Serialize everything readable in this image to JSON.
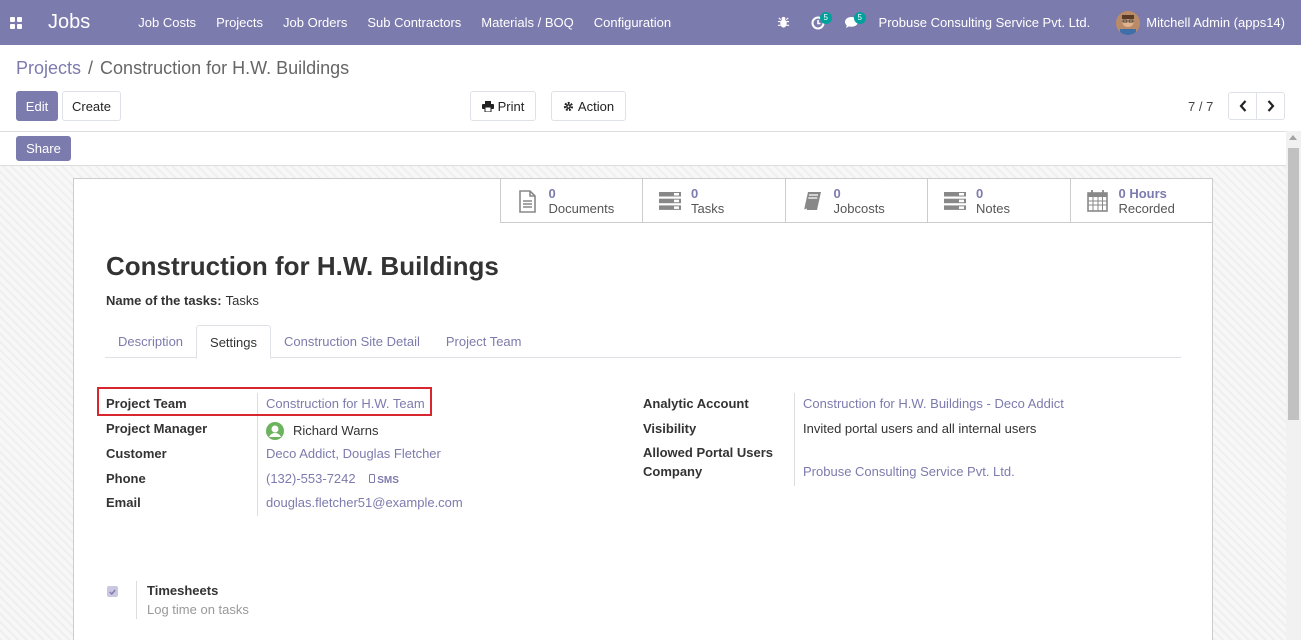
{
  "navbar": {
    "app_name": "Jobs",
    "menu": [
      "Job Costs",
      "Projects",
      "Job Orders",
      "Sub Contractors",
      "Materials / BOQ",
      "Configuration"
    ],
    "activity_count": "5",
    "messages_count": "5",
    "company": "Probuse Consulting Service Pvt. Ltd.",
    "user": "Mitchell Admin (apps14)"
  },
  "breadcrumb": {
    "parent": "Projects",
    "separator": "/",
    "current": "Construction for H.W. Buildings"
  },
  "controls": {
    "edit": "Edit",
    "create": "Create",
    "print": "Print",
    "action": "Action",
    "pager": "7 / 7",
    "share": "Share"
  },
  "smart_buttons": [
    {
      "value": "0",
      "label": "Documents",
      "icon": "document-icon"
    },
    {
      "value": "0",
      "label": "Tasks",
      "icon": "tasks-icon"
    },
    {
      "value": "0",
      "label": "Jobcosts",
      "icon": "book-icon"
    },
    {
      "value": "0",
      "label": "Notes",
      "icon": "notes-icon"
    },
    {
      "value": "0 Hours",
      "label": "Recorded",
      "icon": "calendar-icon"
    }
  ],
  "record": {
    "title": "Construction for H.W. Buildings",
    "tasks_label": "Name of the tasks:",
    "tasks_value": "Tasks"
  },
  "tabs": [
    "Description",
    "Settings",
    "Construction Site Detail",
    "Project Team"
  ],
  "left_fields": {
    "project_team": {
      "label": "Project Team",
      "value": "Construction for H.W. Team"
    },
    "project_manager": {
      "label": "Project Manager",
      "value": "Richard Warns"
    },
    "customer": {
      "label": "Customer",
      "value": "Deco Addict, Douglas Fletcher"
    },
    "phone": {
      "label": "Phone",
      "value": "(132)-553-7242",
      "sms": "SMS"
    },
    "email": {
      "label": "Email",
      "value": "douglas.fletcher51@example.com"
    }
  },
  "right_fields": {
    "analytic_account": {
      "label": "Analytic Account",
      "value": "Construction for H.W. Buildings - Deco Addict"
    },
    "visibility": {
      "label": "Visibility",
      "value": "Invited portal users and all internal users"
    },
    "allowed_portal_users": {
      "label": "Allowed Portal Users",
      "value": ""
    },
    "company": {
      "label": "Company",
      "value": "Probuse Consulting Service Pvt. Ltd."
    }
  },
  "timesheets": {
    "label": "Timesheets",
    "help": "Log time on tasks",
    "checked": true
  },
  "colors": {
    "brand": "#7c7bad",
    "badge": "#00a09d",
    "highlight": "#d7262d"
  }
}
